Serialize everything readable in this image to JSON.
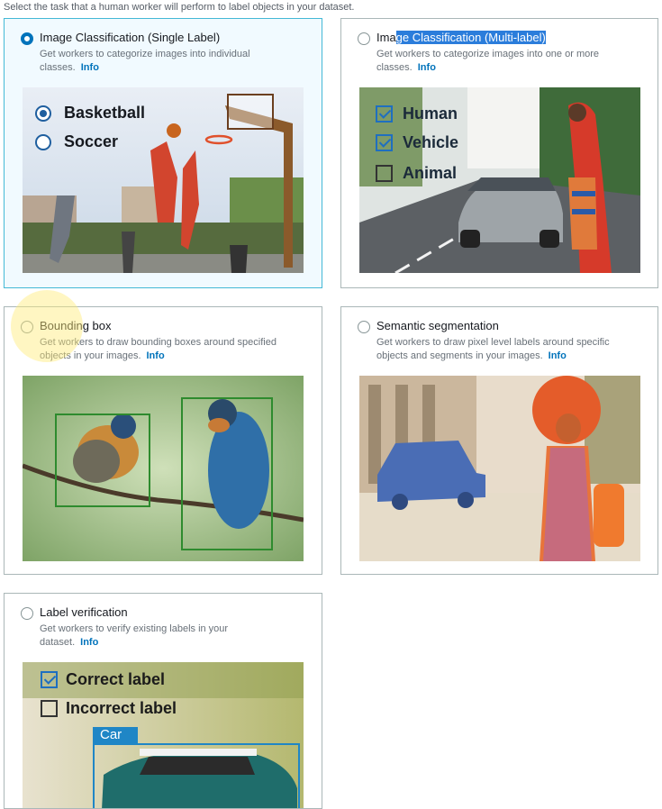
{
  "instruction": "Select the task that a human worker will perform to label objects in your dataset.",
  "cards": [
    {
      "title": "Image Classification (Single Label)",
      "desc": "Get workers to categorize images into individual classes.",
      "info": "Info",
      "selected": true,
      "labels": [
        "Basketball",
        "Soccer"
      ]
    },
    {
      "title_prefix": "Ima",
      "title_highlight": "ge Classification (Multi-label)",
      "desc": "Get workers to categorize images into one or more classes.",
      "info": "Info",
      "labels": [
        "Human",
        "Vehicle",
        "Animal"
      ]
    },
    {
      "title": "Bounding box",
      "desc": "Get workers to draw bounding boxes around specified objects in your images.",
      "info": "Info"
    },
    {
      "title": "Semantic segmentation",
      "desc": "Get workers to draw pixel level labels around specific objects and segments in your images.",
      "info": "Info"
    },
    {
      "title": "Label verification",
      "desc": "Get workers to verify existing labels in your dataset.",
      "info": "Info",
      "labels": [
        "Correct label",
        "Incorrect label"
      ],
      "box_tag": "Car"
    }
  ],
  "colors": {
    "selected_border": "#44b9d6",
    "accent": "#0073bb",
    "box_green": "#2e8b2e"
  }
}
